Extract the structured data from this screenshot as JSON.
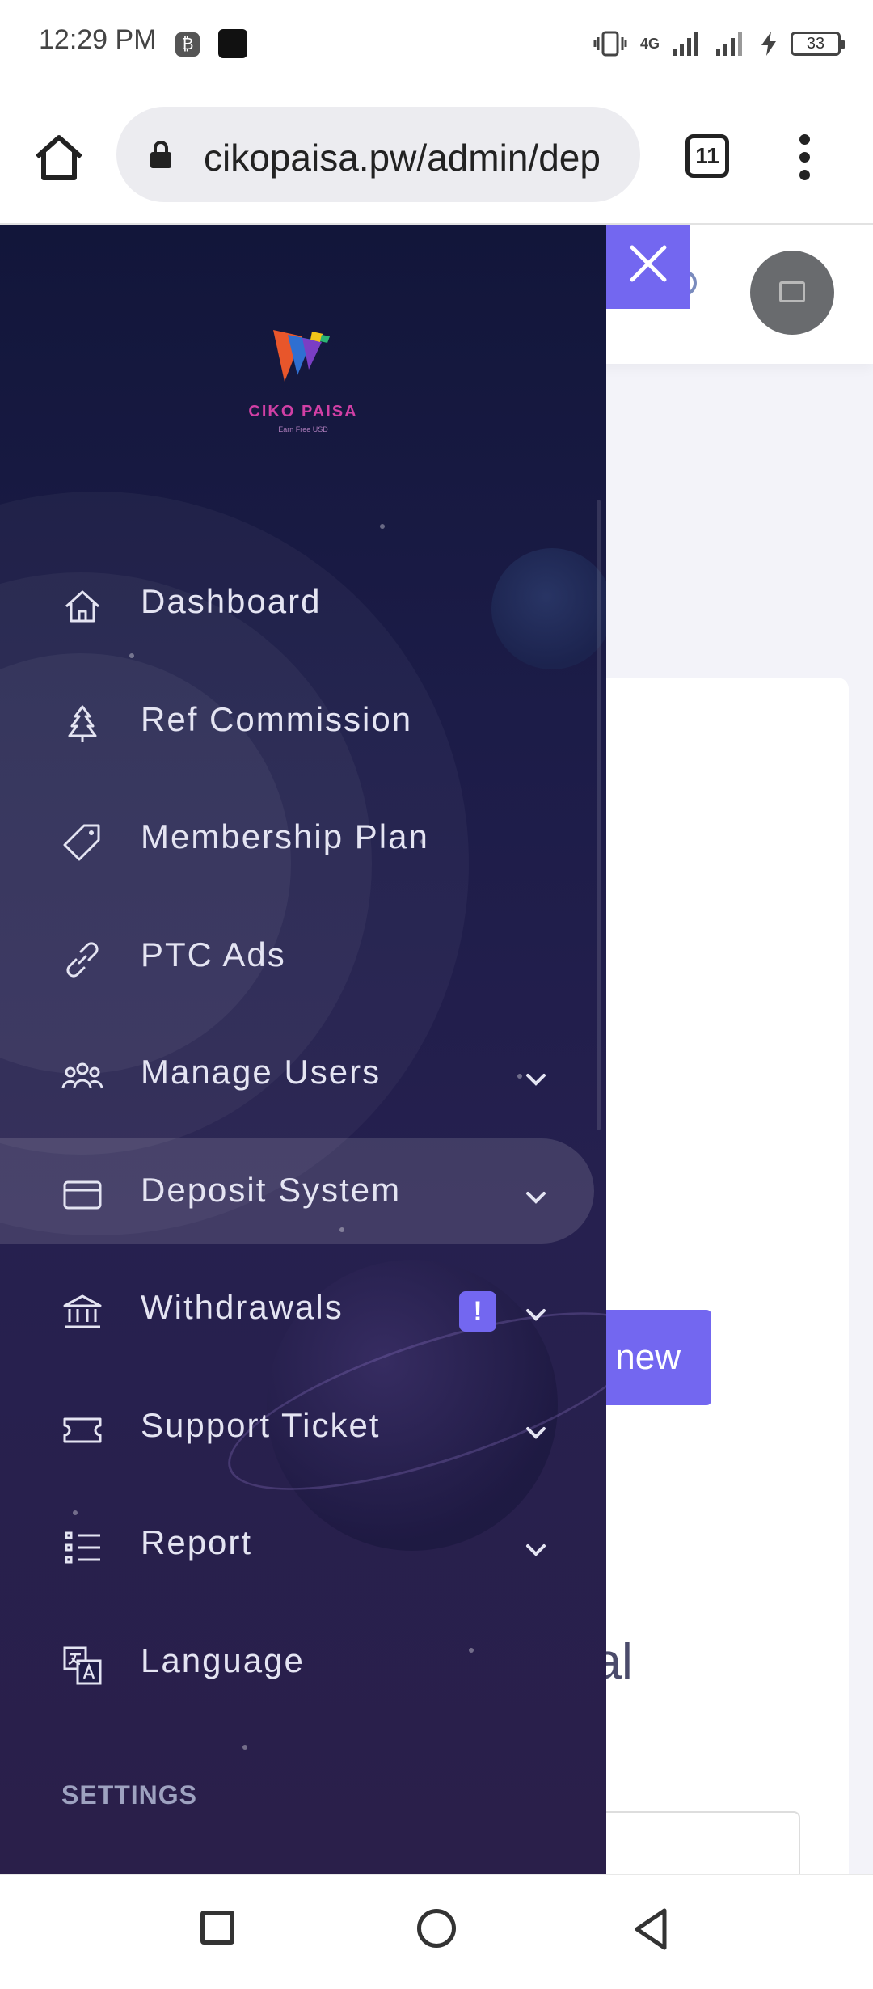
{
  "status_bar": {
    "time": "12:29 PM",
    "network": "4G",
    "battery": "33"
  },
  "browser": {
    "url": "cikopaisa.pw/admin/dep",
    "tab_count": "11"
  },
  "sidebar": {
    "logo_text": "CIKO PAISA",
    "logo_tagline": "Earn Free USD",
    "items": [
      {
        "label": "Dashboard",
        "icon": "home-icon",
        "has_chevron": false
      },
      {
        "label": "Ref Commission",
        "icon": "tree-icon",
        "has_chevron": false
      },
      {
        "label": "Membership Plan",
        "icon": "tag-icon",
        "has_chevron": false
      },
      {
        "label": "PTC Ads",
        "icon": "link-icon",
        "has_chevron": false
      },
      {
        "label": "Manage Users",
        "icon": "users-icon",
        "has_chevron": true
      },
      {
        "label": "Deposit System",
        "icon": "credit-card-icon",
        "has_chevron": true,
        "active": true
      },
      {
        "label": "Withdrawals",
        "icon": "bank-icon",
        "has_chevron": true,
        "badge": "!"
      },
      {
        "label": "Support Ticket",
        "icon": "ticket-icon",
        "has_chevron": true
      },
      {
        "label": "Report",
        "icon": "list-icon",
        "has_chevron": true
      },
      {
        "label": "Language",
        "icon": "translate-icon",
        "has_chevron": false
      }
    ],
    "section_settings": "SETTINGS"
  },
  "page": {
    "add_button_partial": "new",
    "heading_partial": "pal"
  },
  "colors": {
    "accent": "#7367f0",
    "sidebar_top": "#12163a",
    "sidebar_bottom": "#2a1f4a"
  }
}
